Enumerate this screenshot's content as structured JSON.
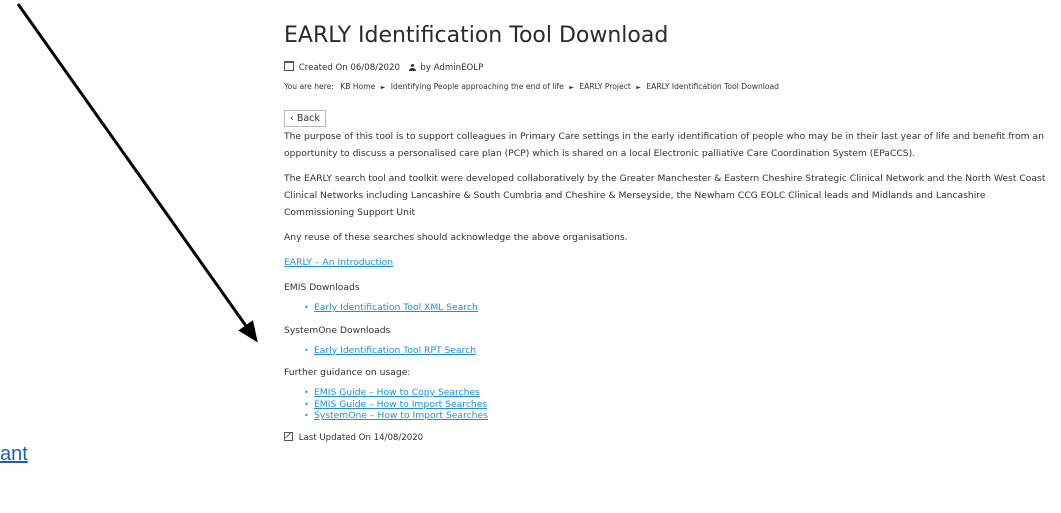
{
  "left_fragment_link": "ant",
  "page": {
    "title": "EARLY Identification Tool Download",
    "created": "Created On 06/08/2020",
    "author": "by AdminEOLP",
    "breadcrumb_prefix": "You are here:",
    "breadcrumbs": [
      "KB Home",
      "Identifying People approaching the end of life",
      "EARLY Project",
      "EARLY Identification Tool Download"
    ],
    "back_label": "Back",
    "paragraph1": "The purpose of this tool is to support colleagues in Primary Care settings in the early identification of people who may be in their last year of life and benefit from an opportunity to discuss a personalised care plan (PCP) which is shared on a local Electronic palliative Care Coordination System (EPaCCS).",
    "paragraph2": "The EARLY search tool and toolkit were developed collaboratively by the Greater Manchester & Eastern Cheshire Strategic Clinical Network and the North West Coast Clinical Networks including Lancashire & South Cumbria and Cheshire & Merseyside, the Newham CCG EOLC Clinical leads and Midlands and Lancashire Commissioning Support Unit",
    "paragraph3": "Any reuse of these searches should acknowledge the above organisations.",
    "intro_link": "EARLY – An Introduction",
    "emis_heading": "EMIS Downloads",
    "emis_links": [
      "Early Identification Tool XML Search"
    ],
    "systemone_heading": "SystemOne Downloads",
    "systemone_links": [
      "Early Identification Tool RPT Search"
    ],
    "guidance_heading": "Further guidance on usage:",
    "guidance_links": [
      "EMIS Guide – How to Copy Searches",
      "EMIS Guide – How to Import Searches",
      "SystemOne – How to Import Searches"
    ],
    "last_updated": "Last Updated On 14/08/2020"
  },
  "colors": {
    "link": "#1e90d6",
    "text": "#333333",
    "arrow": "#000000"
  }
}
